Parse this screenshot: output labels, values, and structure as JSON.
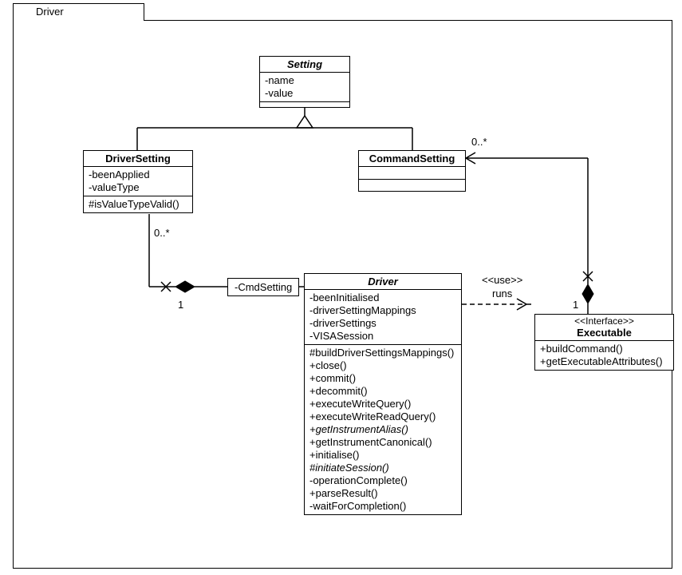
{
  "package": {
    "name": "Driver"
  },
  "classes": {
    "setting": {
      "name": "Setting",
      "abstract": true,
      "attrs": [
        "-name",
        "-value"
      ],
      "ops": []
    },
    "driverSetting": {
      "name": "DriverSetting",
      "abstract": false,
      "attrs": [
        "-beenApplied",
        "-valueType"
      ],
      "ops": [
        "#isValueTypeValid()"
      ]
    },
    "commandSetting": {
      "name": "CommandSetting",
      "abstract": false,
      "attrs": [],
      "ops": []
    },
    "driver": {
      "name": "Driver",
      "abstract": true,
      "attrs": [
        "-beenInitialised",
        "-driverSettingMappings",
        "-driverSettings",
        "-VISASession"
      ],
      "ops": [
        "#buildDriverSettingsMappings()",
        "+close()",
        "+commit()",
        "+decommit()",
        "+executeWriteQuery()",
        "+executeWriteReadQuery()",
        "+getInstrumentAlias()",
        "+getInstrumentCanonical()",
        "+initialise()",
        "#initiateSession()",
        "-operationComplete()",
        "+parseResult()",
        "-waitForCompletion()"
      ],
      "opItalic": [
        false,
        false,
        false,
        false,
        false,
        false,
        true,
        false,
        false,
        true,
        false,
        false,
        false
      ]
    },
    "executable": {
      "name": "Executable",
      "stereotype": "<<Interface>>",
      "ops": [
        "+buildCommand()",
        "+getExecutableAttributes()"
      ]
    }
  },
  "relations": {
    "use": {
      "stereotype": "<<use>>",
      "label": "runs"
    },
    "cmdSettingRole": "-CmdSetting",
    "mult": {
      "driverSettingEnd": "0..*",
      "driverEnd1": "1",
      "commandSettingEnd": "0..*",
      "executableEnd1": "1"
    }
  }
}
